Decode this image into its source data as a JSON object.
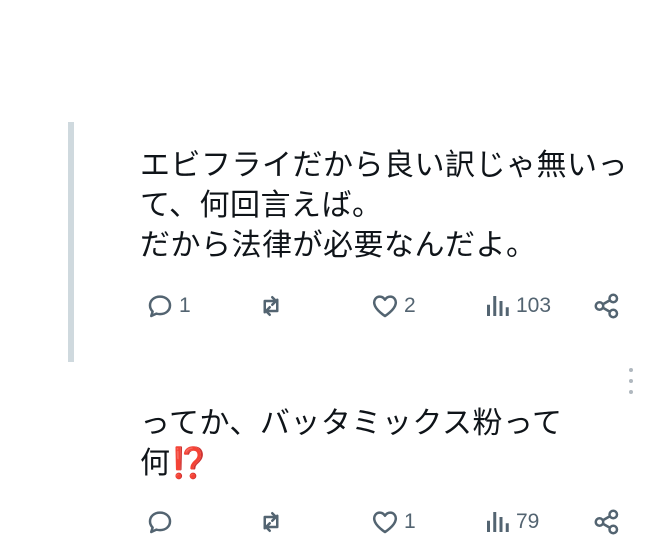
{
  "tweets": [
    {
      "text": "エビフライだから良い訳じゃ無いって、何回言えば。\nだから法律が必要なんだよ。",
      "replies": "1",
      "retweets": "",
      "likes": "2",
      "views": "103"
    },
    {
      "text": "ってか、バッタミックス粉って\n何",
      "emoji": "⁉️",
      "replies": "",
      "retweets": "",
      "likes": "1",
      "views": "79"
    }
  ],
  "icons": {
    "reply": "reply-icon",
    "retweet": "retweet-icon",
    "like": "heart-icon",
    "views": "views-icon",
    "share": "share-icon",
    "more": "more-icon"
  },
  "colors": {
    "text": "#0f1419",
    "icon": "#536471",
    "thread_line": "#cfd9de",
    "emoji": "#ff3dcf"
  }
}
